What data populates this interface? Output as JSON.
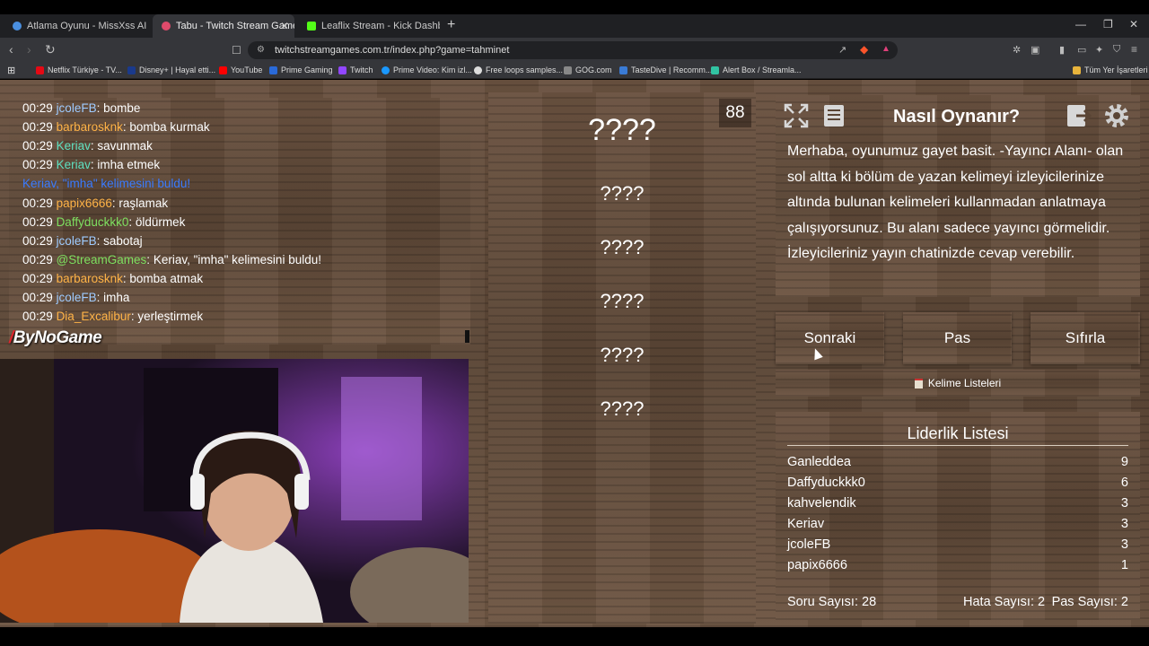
{
  "browser": {
    "tabs": [
      {
        "title": "Atlama Oyunu - MissXss AI Bot Syste",
        "color": "#4a8fe0"
      },
      {
        "title": "Tabu - Twitch Stream Games",
        "color": "#e04a6b"
      },
      {
        "title": "Leaflix Stream - Kick Dashboard",
        "color": "#53fc18"
      }
    ],
    "url": "twitchstreamgames.com.tr/index.php?game=tahminet",
    "bookmarks": [
      {
        "label": "Netflix Türkiye - TV...",
        "color": "#e50914"
      },
      {
        "label": "Disney+ | Hayal etti...",
        "color": "#1a3a8c"
      },
      {
        "label": "YouTube",
        "color": "#ff0000"
      },
      {
        "label": "Prime Gaming",
        "color": "#2a6ad8"
      },
      {
        "label": "Twitch",
        "color": "#9146ff"
      },
      {
        "label": "Prime Video: Kim izl...",
        "color": "#1a98ff"
      },
      {
        "label": "Free loops samples...",
        "color": "#dddddd"
      },
      {
        "label": "GOG.com",
        "color": "#888888"
      },
      {
        "label": "TasteDive | Recomm...",
        "color": "#3a7bd5"
      },
      {
        "label": "Alert Box / Streamla...",
        "color": "#31c3a2"
      }
    ],
    "all_bookmarks": "Tüm Yer İşaretleri"
  },
  "chat": [
    {
      "time": "00:29",
      "user": "jcoleFB",
      "color": "#9ecbff",
      "msg": "bombe"
    },
    {
      "time": "00:29",
      "user": "barbarosknk",
      "color": "#ffb347",
      "msg": "bomba kurmak"
    },
    {
      "time": "00:29",
      "user": "Keriav",
      "color": "#5fe0c0",
      "msg": "savunmak"
    },
    {
      "time": "00:29",
      "user": "Keriav",
      "color": "#5fe0c0",
      "msg": "imha etmek"
    },
    {
      "time": "",
      "user": "",
      "color": "#3a7bff",
      "msg": "Keriav, \"imha\" kelimesini buldu!"
    },
    {
      "time": "00:29",
      "user": "papix6666",
      "color": "#ffb347",
      "msg": "raşlamak"
    },
    {
      "time": "00:29",
      "user": "Daffyduckkk0",
      "color": "#7fe060",
      "msg": "öldürmek"
    },
    {
      "time": "00:29",
      "user": "jcoleFB",
      "color": "#9ecbff",
      "msg": "sabotaj"
    },
    {
      "time": "00:29",
      "user": "@StreamGames",
      "color": "#7fe060",
      "msg": "Keriav, \"imha\" kelimesini buldu!"
    },
    {
      "time": "00:29",
      "user": "barbarosknk",
      "color": "#ffb347",
      "msg": "bomba atmak"
    },
    {
      "time": "00:29",
      "user": "jcoleFB",
      "color": "#9ecbff",
      "msg": "imha"
    },
    {
      "time": "00:29",
      "user": "Dia_Excalibur",
      "color": "#ffb347",
      "msg": "yerleştirmek"
    }
  ],
  "logo": {
    "prefix": "/",
    "text": "ByNoGame"
  },
  "game": {
    "counter": "88",
    "main_word": "????",
    "words": [
      "????",
      "????",
      "????",
      "????",
      "????"
    ]
  },
  "help": {
    "title": "Nasıl Oynanır?",
    "text": "Merhaba, oyunumuz gayet basit. -Yayıncı Alanı- olan sol altta ki bölüm de yazan kelimeyi izleyicilerinize altında bulunan kelimeleri kullanmadan anlatmaya çalışıyorsunuz. Bu alanı sadece yayıncı görmelidir. İzleyicileriniz yayın chatinizde cevap verebilir."
  },
  "actions": {
    "next": "Sonraki",
    "pass": "Pas",
    "reset": "Sıfırla",
    "word_lists": "Kelime Listeleri"
  },
  "leaderboard": {
    "title": "Liderlik Listesi",
    "rows": [
      {
        "name": "Ganleddea",
        "score": "9"
      },
      {
        "name": "Daffyduckkk0",
        "score": "6"
      },
      {
        "name": "kahvelendik",
        "score": "3"
      },
      {
        "name": "Keriav",
        "score": "3"
      },
      {
        "name": "jcoleFB",
        "score": "3"
      },
      {
        "name": "papix6666",
        "score": "1"
      }
    ]
  },
  "stats": {
    "questions": "Soru Sayısı: 28",
    "errors": "Hata Sayısı: 2",
    "passes": "Pas Sayısı: 2"
  }
}
